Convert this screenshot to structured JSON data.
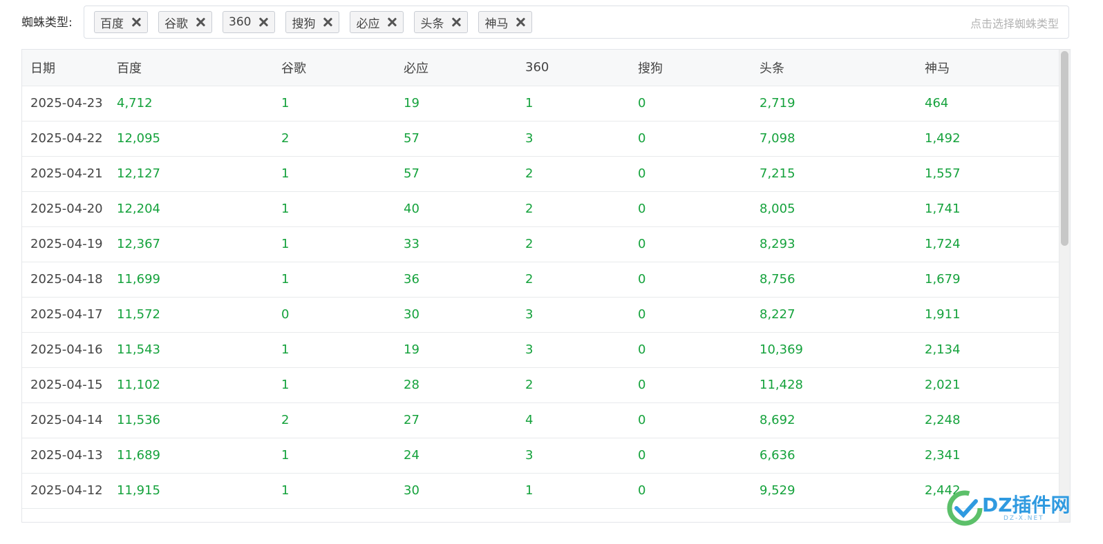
{
  "filter": {
    "label": "蜘蛛类型:",
    "tags": [
      "百度",
      "谷歌",
      "360",
      "搜狗",
      "必应",
      "头条",
      "神马"
    ],
    "placeholder": "点击选择蜘蛛类型"
  },
  "table": {
    "columns": [
      "日期",
      "百度",
      "谷歌",
      "必应",
      "360",
      "搜狗",
      "头条",
      "神马"
    ],
    "rows": [
      [
        "2025-04-23",
        "4,712",
        "1",
        "19",
        "1",
        "0",
        "2,719",
        "464"
      ],
      [
        "2025-04-22",
        "12,095",
        "2",
        "57",
        "3",
        "0",
        "7,098",
        "1,492"
      ],
      [
        "2025-04-21",
        "12,127",
        "1",
        "57",
        "2",
        "0",
        "7,215",
        "1,557"
      ],
      [
        "2025-04-20",
        "12,204",
        "1",
        "40",
        "2",
        "0",
        "8,005",
        "1,741"
      ],
      [
        "2025-04-19",
        "12,367",
        "1",
        "33",
        "2",
        "0",
        "8,293",
        "1,724"
      ],
      [
        "2025-04-18",
        "11,699",
        "1",
        "36",
        "2",
        "0",
        "8,756",
        "1,679"
      ],
      [
        "2025-04-17",
        "11,572",
        "0",
        "30",
        "3",
        "0",
        "8,227",
        "1,911"
      ],
      [
        "2025-04-16",
        "11,543",
        "1",
        "19",
        "3",
        "0",
        "10,369",
        "2,134"
      ],
      [
        "2025-04-15",
        "11,102",
        "1",
        "28",
        "2",
        "0",
        "11,428",
        "2,021"
      ],
      [
        "2025-04-14",
        "11,536",
        "2",
        "27",
        "4",
        "0",
        "8,692",
        "2,248"
      ],
      [
        "2025-04-13",
        "11,689",
        "1",
        "24",
        "3",
        "0",
        "6,636",
        "2,341"
      ],
      [
        "2025-04-12",
        "11,915",
        "1",
        "30",
        "1",
        "0",
        "9,529",
        "2,442"
      ]
    ]
  },
  "watermark": {
    "text": "DZ插件网",
    "sub": "DZ-X.NET"
  },
  "colors": {
    "value": "#15a23c",
    "header_bg": "#f7f8f9",
    "watermark": "#2f9ae0"
  }
}
